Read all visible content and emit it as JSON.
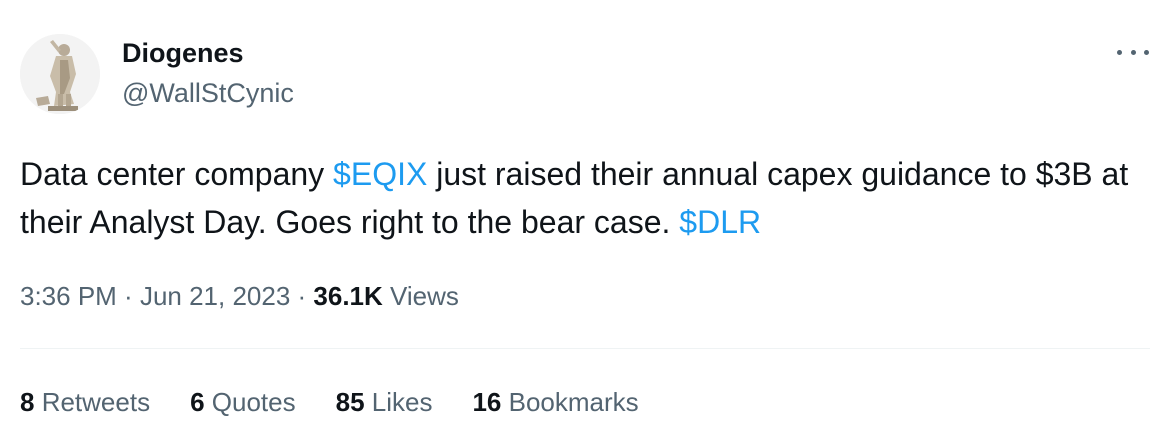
{
  "author": {
    "display_name": "Diogenes",
    "handle": "@WallStCynic",
    "avatar_icon": "statue-avatar"
  },
  "more_icon": "more-horizontal-icon",
  "tweet": {
    "parts": [
      "Data center company ",
      "$EQIX",
      " just raised their annual capex guidance to $3B at their Analyst Day. Goes right to the bear case. ",
      "$DLR"
    ]
  },
  "meta": {
    "time": "3:36 PM",
    "sep1": " · ",
    "date": "Jun 21, 2023",
    "sep2": " · ",
    "views_count": "36.1K",
    "views_label": " Views"
  },
  "stats": {
    "retweets": {
      "count": "8",
      "label": " Retweets"
    },
    "quotes": {
      "count": "6",
      "label": " Quotes"
    },
    "likes": {
      "count": "85",
      "label": " Likes"
    },
    "bookmarks": {
      "count": "16",
      "label": " Bookmarks"
    }
  },
  "colors": {
    "link": "#1d9bf0",
    "secondary_text": "#536471",
    "primary_text": "#0f1419"
  }
}
